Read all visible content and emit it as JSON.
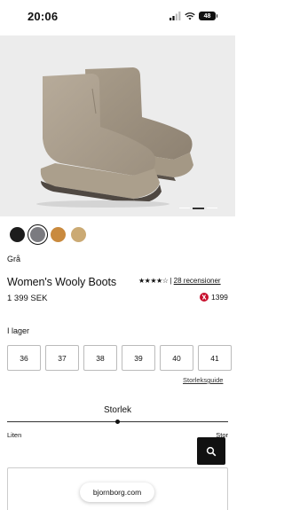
{
  "status_bar": {
    "time": "20:06",
    "battery": "48"
  },
  "product": {
    "color_name": "Grå",
    "title": "Women's Wooly Boots",
    "price": "1 399 SEK",
    "rating_stars": "★★★★☆",
    "reviews": "28 recensioner",
    "points": "1399"
  },
  "swatches": [
    {
      "color": "#1c1c1c"
    },
    {
      "color": "#7b7b80",
      "selected": true
    },
    {
      "color": "#c98a3e"
    },
    {
      "color": "#cbaa74"
    }
  ],
  "sizes": {
    "label": "I lager",
    "options": [
      "36",
      "37",
      "38",
      "39",
      "40",
      "41"
    ],
    "guide": "Storleksguide"
  },
  "fit_slider": {
    "label": "Storlek",
    "min_label": "Liten",
    "max_label": "Stor",
    "value": 0.5
  },
  "browser": {
    "url": "bjornborg.com"
  },
  "icons": {
    "signal": "signal-icon",
    "wifi": "wifi-icon",
    "battery": "battery-icon",
    "search": "search-icon",
    "points": "points-icon"
  }
}
